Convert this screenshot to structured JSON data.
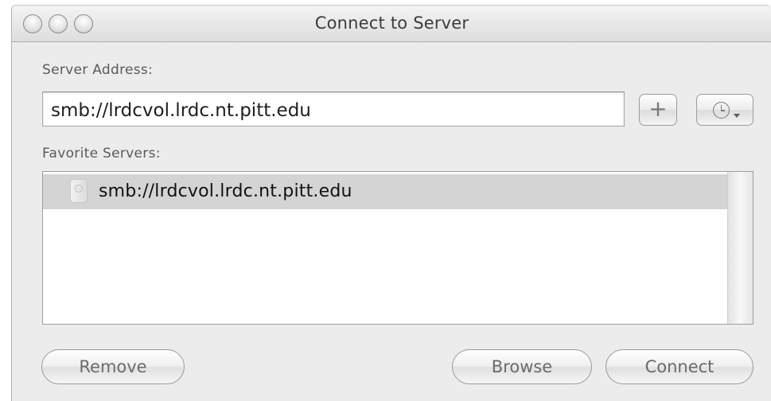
{
  "window": {
    "title": "Connect to Server"
  },
  "server_address": {
    "label": "Server Address:",
    "value": "smb://lrdcvol.lrdc.nt.pitt.edu",
    "add_button_label": "+",
    "recent_button_icon": "clock-icon"
  },
  "favorites": {
    "label": "Favorite Servers:",
    "items": [
      {
        "label": "smb://lrdcvol.lrdc.nt.pitt.edu",
        "icon": "server-icon",
        "selected": true
      }
    ]
  },
  "buttons": {
    "remove": "Remove",
    "browse": "Browse",
    "connect": "Connect"
  },
  "colors": {
    "window_bg": "#ececec",
    "selection_bg": "#d4d4d4"
  }
}
